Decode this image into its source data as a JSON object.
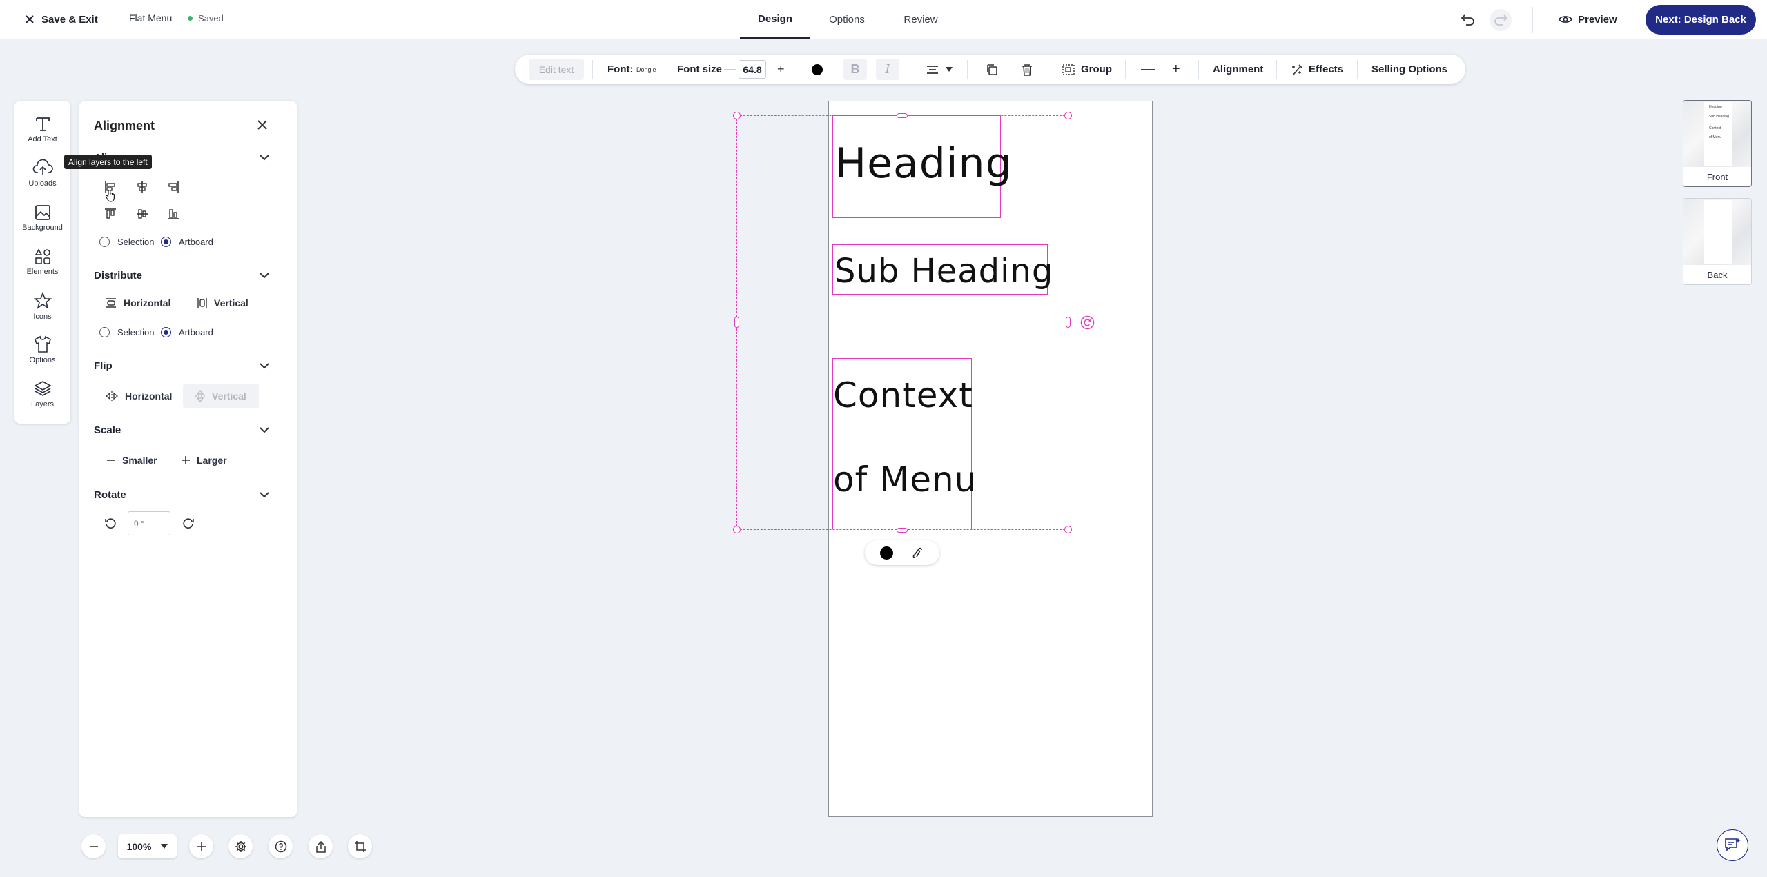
{
  "topbar": {
    "save_exit_label": "Save & Exit",
    "project_name": "Flat Menu",
    "status": "Saved",
    "tabs": [
      {
        "label": "Design",
        "active": true
      },
      {
        "label": "Options",
        "active": false
      },
      {
        "label": "Review",
        "active": false
      }
    ],
    "preview_label": "Preview",
    "next_label": "Next: Design Back"
  },
  "toolbar": {
    "edit_text_label": "Edit text",
    "font_label": "Font:",
    "font_value": "Dongle",
    "font_size_label": "Font size",
    "font_size_value": "64.8",
    "minus_glyph": "—",
    "plus_glyph": "+",
    "bold_glyph": "B",
    "italic_glyph": "I",
    "group_label": "Group",
    "alignment_label": "Alignment",
    "effects_label": "Effects",
    "selling_options_label": "Selling Options",
    "text_color": "#000000"
  },
  "left_rail": {
    "items": [
      {
        "label": "Add Text",
        "icon": "text-icon"
      },
      {
        "label": "Uploads",
        "icon": "upload-icon"
      },
      {
        "label": "Background",
        "icon": "image-icon"
      },
      {
        "label": "Elements",
        "icon": "shapes-icon"
      },
      {
        "label": "Icons",
        "icon": "star-icon"
      },
      {
        "label": "Options",
        "icon": "shirt-icon"
      },
      {
        "label": "Layers",
        "icon": "layers-icon"
      }
    ]
  },
  "alignment_panel": {
    "title": "Alignment",
    "align_section_title": "Align",
    "align_relative": {
      "selection_label": "Selection",
      "artboard_label": "Artboard",
      "selected": "Artboard"
    },
    "distribute_title": "Distribute",
    "distribute_horizontal": "Horizontal",
    "distribute_vertical": "Vertical",
    "distribute_relative": {
      "selection_label": "Selection",
      "artboard_label": "Artboard",
      "selected": "Artboard"
    },
    "flip_title": "Flip",
    "flip_horizontal": "Horizontal",
    "flip_vertical": "Vertical",
    "scale_title": "Scale",
    "scale_smaller": "Smaller",
    "scale_larger": "Larger",
    "rotate_title": "Rotate",
    "rotate_value": "0 °"
  },
  "tooltip": {
    "text": "Align layers to the left"
  },
  "canvas": {
    "heading": "Heading",
    "subheading": "Sub Heading",
    "context_line1": "Context",
    "context_line2": "of Menu",
    "selection_color": "#e23cbd"
  },
  "pages": {
    "front_label": "Front",
    "back_label": "Back",
    "thumb_heading": "Heading",
    "thumb_subheading": "Sub Heading",
    "thumb_context": "Context",
    "thumb_menu": "of Menu"
  },
  "zoom": {
    "value": "100%"
  },
  "colors": {
    "brand": "#222a88",
    "accent": "#e23cbd",
    "saved": "#3cb371"
  }
}
